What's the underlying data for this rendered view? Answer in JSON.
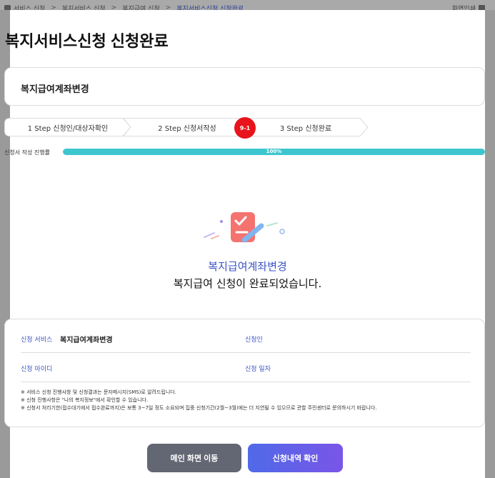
{
  "breadcrumb": {
    "items": [
      "서비스 신청",
      "복지서비스 신청",
      "복지급여 신청",
      "복지서비스신청 신청완료"
    ],
    "print_label": "화면인쇄"
  },
  "page_title": "복지서비스신청 신청완료",
  "service_name": "복지급여계좌변경",
  "steps": [
    {
      "label": "1 Step 신청인/대상자확인"
    },
    {
      "label": "2 Step 신청서작성"
    },
    {
      "label": "3 Step 신청완료"
    }
  ],
  "step_badge": "9-1",
  "progress": {
    "label": "신청서 작성 진행률",
    "percent_text": "100%",
    "value": 100
  },
  "completion": {
    "service": "복지급여계좌변경",
    "message": "복지급여 신청이 완료되었습니다."
  },
  "info": {
    "service_label": "신청 서비스",
    "service_value": "복지급여계좌변경",
    "applicant_label": "신청인",
    "id_label": "신청 아이디",
    "date_label": "신청 일자",
    "notes": [
      "※ 서비스 신청 진행사항 및 신청결과는 문자메시지(SMS)로 알려드립니다.",
      "※ 신청 진행사항은 \"나의 복지정보\"에서 확인할 수 있습니다.",
      "※ 신청서 처리기한(접수대기에서 접수완료까지)은 보통 3~7일 정도 소요되며 집중 신청기간(2월~3월)에는 더 지연될 수 있으므로 관할 주민센터로 문의하시기 바랍니다."
    ]
  },
  "buttons": {
    "main_label": "메인 화면 이동",
    "history_label": "신청내역 확인"
  },
  "colors": {
    "accent_blue": "#3a53c5",
    "progress": "#3ec6cf",
    "badge_red": "#e8141b",
    "illustration": "#f4736f"
  }
}
